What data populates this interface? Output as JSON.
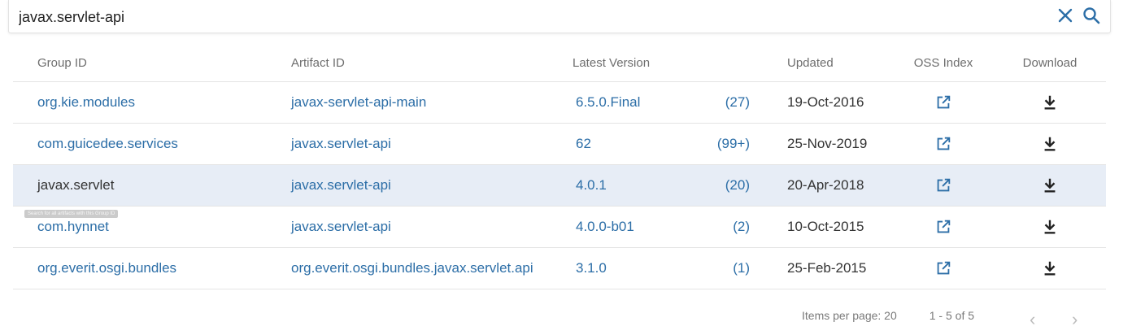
{
  "search": {
    "value": "javax.servlet-api",
    "clear_icon": "close-icon",
    "search_icon": "search-icon"
  },
  "table": {
    "headers": {
      "group_id": "Group ID",
      "artifact_id": "Artifact ID",
      "latest_version": "Latest Version",
      "updated": "Updated",
      "oss_index": "OSS Index",
      "download": "Download"
    },
    "rows": [
      {
        "group": "org.kie.modules",
        "artifact": "javax-servlet-api-main",
        "version": "6.5.0.Final",
        "count": "(27)",
        "updated": "19-Oct-2016"
      },
      {
        "group": "com.guicedee.services",
        "artifact": "javax.servlet-api",
        "version": "62",
        "count": "(99+)",
        "updated": "25-Nov-2019"
      },
      {
        "group": "javax.servlet",
        "artifact": "javax.servlet-api",
        "version": "4.0.1",
        "count": "(20)",
        "updated": "20-Apr-2018"
      },
      {
        "group": "com.hynnet",
        "artifact": "javax.servlet-api",
        "version": "4.0.0-b01",
        "count": "(2)",
        "updated": "10-Oct-2015"
      },
      {
        "group": "org.everit.osgi.bundles",
        "artifact": "org.everit.osgi.bundles.javax.servlet.api",
        "version": "3.1.0",
        "count": "(1)",
        "updated": "25-Feb-2015"
      }
    ]
  },
  "tooltip": {
    "text": "Search for all artifacts with this Group ID"
  },
  "paginator": {
    "items_per_page": "Items per page: 20",
    "range": "1 - 5 of 5"
  },
  "colors": {
    "link": "#2c6ea7",
    "highlight_row": "#e7edf6",
    "header_text": "#6e6e6e"
  }
}
